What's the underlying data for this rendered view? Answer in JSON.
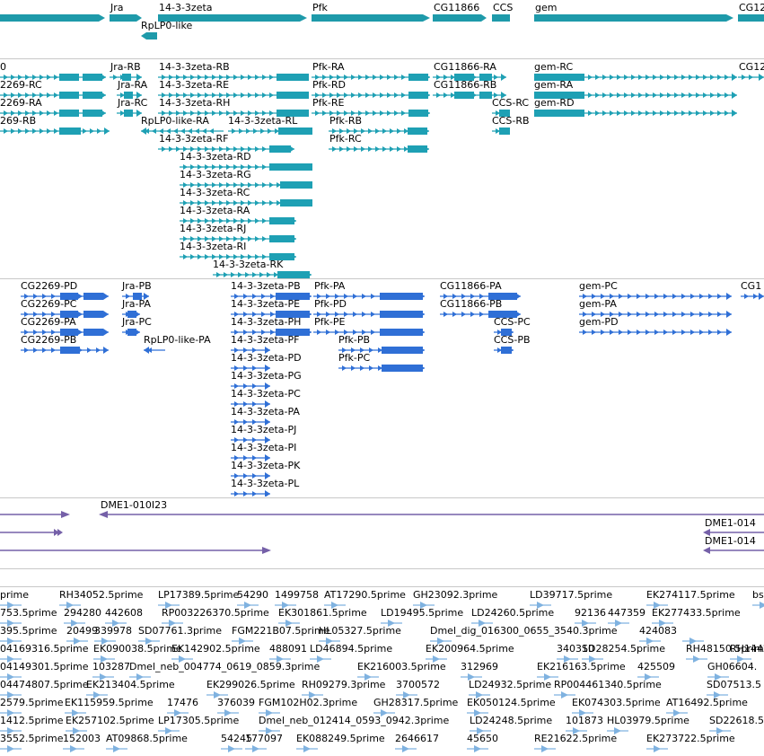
{
  "colors": {
    "gene": "#1e9aaa",
    "transcript": "#1ea0b4",
    "protein": "#2f6fd6",
    "clone": "#7560a8",
    "est": "#7fb2e0",
    "separator": "#c8c8c8"
  },
  "tracks": {
    "genes": {
      "features": [
        {
          "label": "Jra",
          "name": "gene-jra"
        },
        {
          "label": "14-3-3zeta",
          "name": "gene-14-3-3zeta"
        },
        {
          "label": "Pfk",
          "name": "gene-pfk"
        },
        {
          "label": "CG11866",
          "name": "gene-cg11866"
        },
        {
          "label": "CCS",
          "name": "gene-ccs"
        },
        {
          "label": "gem",
          "name": "gene-gem"
        },
        {
          "label": "CG12",
          "name": "gene-cg12-partial"
        },
        {
          "label": "RpLP0-like",
          "name": "gene-rplp0-like"
        }
      ]
    },
    "transcripts": {
      "features": [
        {
          "label": "0"
        },
        {
          "label": "2269-RC"
        },
        {
          "label": "2269-RA"
        },
        {
          "label": "269-RB"
        },
        {
          "label": "Jra-RB"
        },
        {
          "label": "Jra-RA"
        },
        {
          "label": "Jra-RC"
        },
        {
          "label": "14-3-3zeta-RB"
        },
        {
          "label": "14-3-3zeta-RE"
        },
        {
          "label": "14-3-3zeta-RH"
        },
        {
          "label": "RpLP0-like-RA"
        },
        {
          "label": "14-3-3zeta-RL"
        },
        {
          "label": "14-3-3zeta-RF"
        },
        {
          "label": "14-3-3zeta-RD"
        },
        {
          "label": "14-3-3zeta-RG"
        },
        {
          "label": "14-3-3zeta-RC"
        },
        {
          "label": "14-3-3zeta-RA"
        },
        {
          "label": "14-3-3zeta-RJ"
        },
        {
          "label": "14-3-3zeta-RI"
        },
        {
          "label": "14-3-3zeta-RK"
        },
        {
          "label": "Pfk-RA"
        },
        {
          "label": "Pfk-RD"
        },
        {
          "label": "Pfk-RE"
        },
        {
          "label": "Pfk-RB"
        },
        {
          "label": "Pfk-RC"
        },
        {
          "label": "CG11866-RA"
        },
        {
          "label": "CG11866-RB"
        },
        {
          "label": "CCS-RC"
        },
        {
          "label": "CCS-RB"
        },
        {
          "label": "gem-RC"
        },
        {
          "label": "gem-RA"
        },
        {
          "label": "gem-RD"
        },
        {
          "label": "CG12"
        }
      ]
    },
    "proteins": {
      "features": [
        {
          "label": "CG2269-PD"
        },
        {
          "label": "CG2269-PC"
        },
        {
          "label": "CG2269-PA"
        },
        {
          "label": "CG2269-PB"
        },
        {
          "label": "Jra-PB"
        },
        {
          "label": "Jra-PA"
        },
        {
          "label": "Jra-PC"
        },
        {
          "label": "RpLP0-like-PA"
        },
        {
          "label": "14-3-3zeta-PB"
        },
        {
          "label": "14-3-3zeta-PE"
        },
        {
          "label": "14-3-3zeta-PH"
        },
        {
          "label": "14-3-3zeta-PF"
        },
        {
          "label": "14-3-3zeta-PD"
        },
        {
          "label": "14-3-3zeta-PG"
        },
        {
          "label": "14-3-3zeta-PC"
        },
        {
          "label": "14-3-3zeta-PA"
        },
        {
          "label": "14-3-3zeta-PJ"
        },
        {
          "label": "14-3-3zeta-PI"
        },
        {
          "label": "14-3-3zeta-PK"
        },
        {
          "label": "14-3-3zeta-PL"
        },
        {
          "label": "Pfk-PA"
        },
        {
          "label": "Pfk-PD"
        },
        {
          "label": "Pfk-PE"
        },
        {
          "label": "Pfk-PB"
        },
        {
          "label": "Pfk-PC"
        },
        {
          "label": "CG11866-PA"
        },
        {
          "label": "CG11866-PB"
        },
        {
          "label": "CCS-PC"
        },
        {
          "label": "CCS-PB"
        },
        {
          "label": "gem-PC"
        },
        {
          "label": "gem-PA"
        },
        {
          "label": "gem-PD"
        },
        {
          "label": "CG1"
        }
      ]
    },
    "clones": {
      "features": [
        {
          "label": "DME1-010I23"
        },
        {
          "label": "DME1-014"
        },
        {
          "label": "DME1-014"
        }
      ]
    },
    "ests": {
      "rows": [
        [
          "prime",
          "RH34052.5prime",
          "LP17389.5prime",
          "54290",
          "1499758",
          "AT17290.5prime",
          "GH23092.3prime",
          "LD39717.5prime",
          "EK274117.5prime",
          "bs"
        ],
        [
          "753.5prime",
          "294280",
          "442608",
          "RP003226370.5prime",
          "EK301861.5prime",
          "LD19495.5prime",
          "LD24260.5prime",
          "92136",
          "447359",
          "EK277433.5prime"
        ],
        [
          "395.5prime",
          "20499",
          "339978",
          "SD07761.3prime",
          "FGM221B07.5prime",
          "HL05327.5prime",
          "Dmel_dig_016300_0655_3540.3prime",
          "424083",
          ""
        ],
        [
          "04169316.5prime",
          "EK090038.5prime",
          "EK142902.5prime",
          "488091",
          "LD46894.5prime",
          "EK200964.5prime",
          "340310",
          "SD28254.5prime",
          "RH48150.5prime",
          "RH14420.5"
        ],
        [
          "04149301.5prime",
          "103287",
          "Dmel_neb_004774_0619_0859.3prime",
          "EK216003.5prime",
          "312969",
          "EK216163.5prime",
          "425509",
          "GH06604."
        ],
        [
          "04474807.5prime",
          "EK213404.5prime",
          "EK299026.5prime",
          "RH09279.3prime",
          "3700572",
          "LD24932.5prime",
          "RP004461340.5prime",
          "SD07513.5"
        ],
        [
          "2579.5prime",
          "EK115959.5prime",
          "17476",
          "376039",
          "FGM102H02.3prime",
          "GH28317.5prime",
          "EK050124.5prime",
          "EK074303.5prime",
          "AT16492.5prime"
        ],
        [
          "1412.5prime",
          "EK257102.5prime",
          "LP17305.5prime",
          "Dmel_neb_012414_0593_0942.3prime",
          "LD24248.5prime",
          "101873",
          "HL03979.5prime",
          "SD22618.5"
        ],
        [
          "3552.5prime",
          "152003",
          "AT09868.5prime",
          "54245",
          "177097",
          "EK088249.5prime",
          "2646617",
          "45650",
          "RE21622.5prime",
          "EK273722.5prime"
        ]
      ]
    }
  }
}
